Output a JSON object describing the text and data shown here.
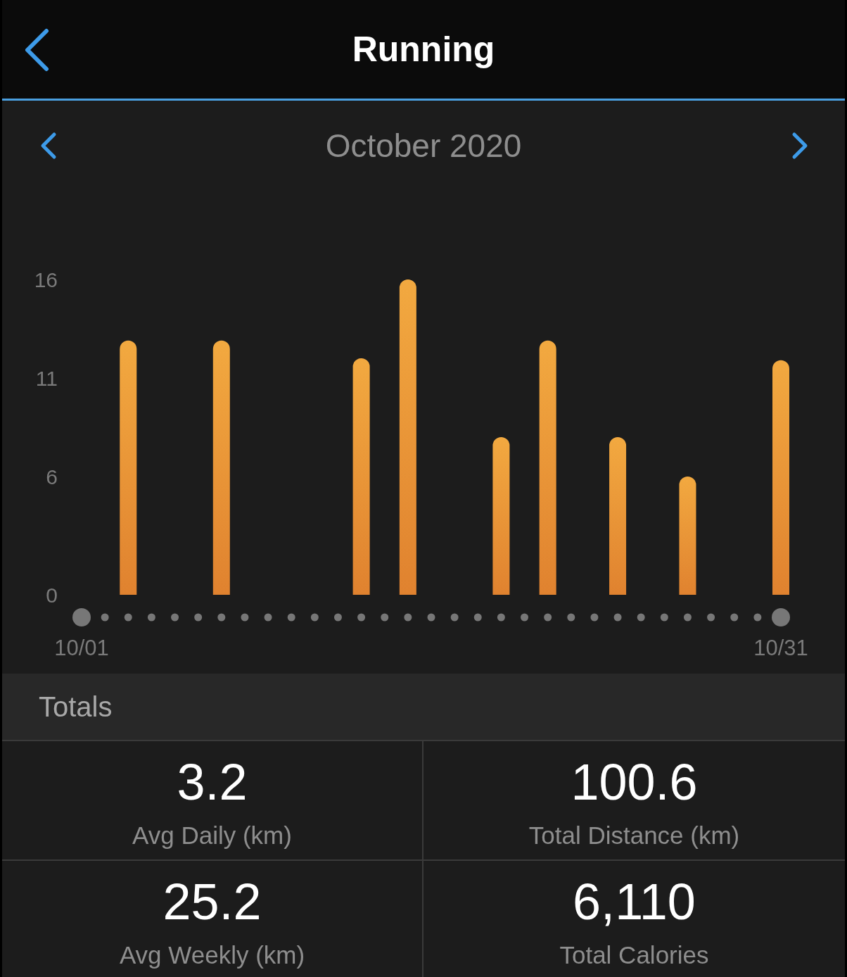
{
  "header": {
    "title": "Running"
  },
  "period": {
    "label": "October 2020"
  },
  "chart": {
    "chart_data": {
      "type": "bar",
      "categories": [
        "10/01",
        null,
        null,
        null,
        null,
        null,
        null,
        null,
        null,
        null,
        null,
        null,
        null,
        null,
        null,
        null,
        null,
        null,
        null,
        null,
        null,
        null,
        null,
        null,
        null,
        null,
        null,
        null,
        null,
        null,
        "10/31"
      ],
      "series": [
        {
          "color": "#f2a940",
          "values": [
            null,
            null,
            12.9,
            null,
            null,
            null,
            12.9,
            null,
            null,
            null,
            null,
            null,
            12.0,
            null,
            16.0,
            null,
            null,
            null,
            8.0,
            null,
            12.9,
            null,
            null,
            8.0,
            null,
            null,
            6.0,
            null,
            null,
            null,
            11.9
          ]
        }
      ],
      "ylim": [
        0,
        16
      ],
      "yticks": [
        0,
        6,
        11,
        16
      ]
    }
  },
  "totals": {
    "title": "Totals",
    "stats": [
      {
        "value": "3.2",
        "label": "Avg Daily (km)"
      },
      {
        "value": "100.6",
        "label": "Total Distance (km)"
      },
      {
        "value": "25.2",
        "label": "Avg Weekly (km)"
      },
      {
        "value": "6,110",
        "label": "Total Calories"
      }
    ]
  }
}
